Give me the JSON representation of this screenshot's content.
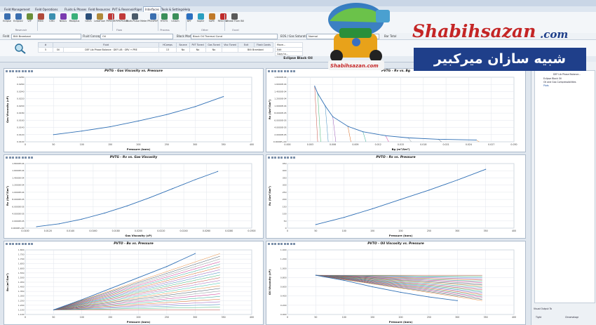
{
  "ribbon_tabs": [
    "Field Management",
    "Field Operations",
    "Fluids & Phases",
    "Field Resources",
    "PVT & Reservoir",
    "Rigel",
    "Interfaces",
    "Tools & Settings",
    "Help"
  ],
  "active_tab_index": 6,
  "ribbon_buttons": [
    {
      "label": "Eclipse",
      "icon": "eclipse-icon",
      "color": "#3a6fb0"
    },
    {
      "label": "Eclipse2",
      "icon": "eclipse2-icon",
      "color": "#3a6fb0"
    },
    {
      "label": "VIP",
      "icon": "vip-icon",
      "color": "#6a8f3a"
    },
    {
      "label": "IMEX",
      "icon": "imex-icon",
      "color": "#b04a3a"
    },
    {
      "label": "CMG",
      "icon": "cmg-icon",
      "color": "#3a8fb0"
    },
    {
      "label": "Nexus",
      "icon": "nexus-icon",
      "color": "#7a3ab0"
    },
    {
      "label": "Mbalplus",
      "icon": "mbal-icon",
      "color": "#3ab07a"
    },
    {
      "label": "GEUS",
      "icon": "geus-icon",
      "color": "#2a4f7a"
    },
    {
      "label": "LedaFlow",
      "icon": "leda-icon",
      "color": "#b08a3a"
    },
    {
      "label": "PIPESIM",
      "icon": "pipesim-icon",
      "color": "#c03a3a"
    },
    {
      "label": "PIPEPHASE",
      "icon": "pipephase-icon",
      "color": "#c03a3a"
    },
    {
      "label": "Multi-Phase Meter",
      "icon": "meter-icon",
      "color": "#4a5a6a"
    },
    {
      "label": "PROSPER",
      "icon": "prosper-icon",
      "color": "#3a6fb0"
    },
    {
      "label": "HYSYS",
      "icon": "hysys-icon",
      "color": "#3a8f5a"
    },
    {
      "label": "Unisim",
      "icon": "unisim-icon",
      "color": "#3a8f5a"
    },
    {
      "label": "BPF",
      "icon": "bpf-icon",
      "color": "#2a6fc0"
    },
    {
      "label": "Saphir",
      "icon": "saphir-icon",
      "color": "#2a9fc0"
    },
    {
      "label": "SAPE",
      "icon": "sape-icon",
      "color": "#c07a2a"
    },
    {
      "label": "RESOLVE",
      "icon": "resolve-icon",
      "color": "#c02a2a"
    },
    {
      "label": "Create From Bill",
      "icon": "create-icon",
      "color": "#5a5a5a"
    }
  ],
  "ribbon_groups": [
    {
      "label": "Reservoir"
    },
    {
      "label": "Flow"
    },
    {
      "label": "Process"
    },
    {
      "label": "Other"
    },
    {
      "label": "Excel"
    }
  ],
  "field_bar": {
    "field_label": "Field",
    "field_value": "Billi Brambani",
    "composition_label": "Fluid Concept",
    "composition_value": "Oil",
    "model_label": "Black Model",
    "model_value": "Black Oil Thermal Cond",
    "eos_label": "EOS / Gas Saturation",
    "eos_value": "Normal",
    "right_label": "Bar Total"
  },
  "header_table": {
    "columns": [
      "#",
      "Fluid",
      "HComps",
      "Source",
      "PVT Tuned",
      "Gas Tuned",
      "Visc Tuned",
      "Exit",
      "Flash Conds"
    ],
    "row": [
      "5",
      "Oil",
      "DEF Lib Phase Balance · DEF LIB · GRV + PRE",
      "13",
      "No",
      "No",
      "No",
      "",
      "Billi Brambani"
    ],
    "side_labels": [
      "Move...",
      "Edit",
      "Copy to..."
    ]
  },
  "content_title": "Eclipse Black Oil",
  "charts": [
    {
      "title": "PVTG - Gas Viscosity vs. Pressure",
      "xlabel": "Pressure (bara)",
      "ylabel": "Gas Viscosity (cP)"
    },
    {
      "title": "PVTG - Rv vs. Bg",
      "xlabel": "Bg (m³/Sm³)",
      "ylabel": "Rv (Sm³/Sm³)"
    },
    {
      "title": "PVTG - Rv vs. Gas Viscosity",
      "xlabel": "Gas Viscosity (cP)",
      "ylabel": "Rv (Sm³/Sm³)"
    },
    {
      "title": "PVTO - Rs vs. Pressure",
      "xlabel": "Pressure (bara)",
      "ylabel": "Rs (Sm³/Sm³)"
    },
    {
      "title": "PVTO - Bo vs. Pressure",
      "xlabel": "Pressure (bara)",
      "ylabel": "Bo (m³/Sm³)"
    },
    {
      "title": "PVTO - Oil Viscosity vs. Pressure",
      "xlabel": "Pressure (bara)",
      "ylabel": "Oil Viscosity (cP)"
    }
  ],
  "chart_data": [
    {
      "type": "line",
      "title": "PVTG - Gas Viscosity vs. Pressure",
      "xlabel": "Pressure (bara)",
      "ylabel": "Gas Viscosity (cP)",
      "xlim": [
        0,
        400
      ],
      "ylim": [
        0.01,
        0.028
      ],
      "x_ticks": [
        "0",
        "50",
        "100",
        "150",
        "200",
        "250",
        "300",
        "350",
        "400"
      ],
      "y_ticks": [
        "0.0100",
        "0.0120",
        "0.0140",
        "0.0160",
        "0.0180",
        "0.0200",
        "0.0220",
        "0.0240",
        "0.0260",
        "0.0280"
      ],
      "series": [
        {
          "x": [
            50,
            100,
            150,
            200,
            250,
            300,
            350
          ],
          "values": [
            0.012,
            0.013,
            0.0142,
            0.0158,
            0.0176,
            0.0198,
            0.0226
          ]
        }
      ]
    },
    {
      "type": "line",
      "title": "PVTG - Rv vs. Bg",
      "xlabel": "Bg (m³/Sm³)",
      "ylabel": "Rv (Sm³/Sm³)",
      "xlim": [
        0,
        0.03
      ],
      "ylim": [
        0,
        0.00018
      ],
      "x_ticks": [
        "0.000",
        "0.003",
        "0.006",
        "0.009",
        "0.012",
        "0.015",
        "0.018",
        "0.021",
        "0.024",
        "0.027",
        "0.030"
      ],
      "y_ticks": [
        "0.0000E+00",
        "2.0000E-05",
        "4.0000E-05",
        "6.0000E-05",
        "8.0000E-05",
        "1.0000E-04",
        "1.2000E-04",
        "1.4000E-04",
        "1.6000E-04",
        "1.8000E-04"
      ],
      "series": [
        {
          "x": [
            0.0036,
            0.004,
            0.005,
            0.006,
            0.008,
            0.01,
            0.013,
            0.016,
            0.02,
            0.025
          ],
          "values": [
            0.000155,
            0.000135,
            0.0001,
            7e-05,
            4.3e-05,
            2.8e-05,
            1.7e-05,
            1.1e-05,
            7e-06,
            5e-06
          ]
        }
      ]
    },
    {
      "type": "line",
      "title": "PVTG - Rv vs. Gas Viscosity",
      "xlabel": "Gas Viscosity (cP)",
      "ylabel": "Rv (Sm³/Sm³)",
      "xlim": [
        0.01,
        0.03
      ],
      "ylim": [
        0,
        0.00018
      ],
      "x_ticks": [
        "0.0100",
        "0.0120",
        "0.0140",
        "0.0160",
        "0.0180",
        "0.0200",
        "0.0220",
        "0.0240",
        "0.0260",
        "0.0280",
        "0.0300"
      ],
      "y_ticks": [
        "0.0000E+00",
        "2.0000E-05",
        "4.0000E-05",
        "6.0000E-05",
        "8.0000E-05",
        "1.0000E-04",
        "1.2000E-04",
        "1.4000E-04",
        "1.6000E-04",
        "1.8000E-04"
      ],
      "series": [
        {
          "x": [
            0.011,
            0.013,
            0.015,
            0.017,
            0.019,
            0.021,
            0.023,
            0.025,
            0.027
          ],
          "values": [
            4e-06,
            1.2e-05,
            2.5e-05,
            4.2e-05,
            6.2e-05,
            8.5e-05,
            0.00011,
            0.000135,
            0.000158
          ]
        }
      ]
    },
    {
      "type": "line",
      "title": "PVTO - Rs vs. Pressure",
      "xlabel": "Pressure (bara)",
      "ylabel": "Rs (Sm³/Sm³)",
      "xlim": [
        0,
        400
      ],
      "ylim": [
        0,
        450
      ],
      "x_ticks": [
        "0",
        "50",
        "100",
        "150",
        "200",
        "250",
        "300",
        "350",
        "400"
      ],
      "y_ticks": [
        "0",
        "50",
        "100",
        "150",
        "200",
        "250",
        "300",
        "350",
        "400",
        "450"
      ],
      "series": [
        {
          "x": [
            50,
            100,
            150,
            200,
            250,
            300,
            350
          ],
          "values": [
            25,
            75,
            135,
            200,
            265,
            335,
            410
          ]
        }
      ]
    },
    {
      "type": "line",
      "title": "PVTO - Bo vs. Pressure",
      "xlabel": "Pressure (bara)",
      "ylabel": "Bo (m³/Sm³)",
      "xlim": [
        0,
        400
      ],
      "ylim": [
        1.1,
        1.8
      ],
      "x_ticks": [
        "0",
        "50",
        "100",
        "150",
        "200",
        "250",
        "300",
        "350",
        "400"
      ],
      "y_ticks": [
        "1.100",
        "1.150",
        "1.200",
        "1.250",
        "1.300",
        "1.350",
        "1.400",
        "1.450",
        "1.500",
        "1.550",
        "1.600",
        "1.650",
        "1.700",
        "1.750",
        "1.800"
      ],
      "series": [
        {
          "x": [
            50,
            100,
            150,
            200,
            250,
            300
          ],
          "values": [
            1.15,
            1.26,
            1.38,
            1.5,
            1.62,
            1.76
          ]
        }
      ]
    },
    {
      "type": "line",
      "title": "PVTO - Oil Viscosity vs. Pressure",
      "xlabel": "Pressure (bara)",
      "ylabel": "Oil Viscosity (cP)",
      "xlim": [
        0,
        400
      ],
      "ylim": [
        0,
        1.4
      ],
      "x_ticks": [
        "0",
        "50",
        "100",
        "150",
        "200",
        "250",
        "300",
        "350",
        "400"
      ],
      "y_ticks": [
        "0.000",
        "0.200",
        "0.400",
        "0.600",
        "0.800",
        "1.000",
        "1.200",
        "1.400"
      ],
      "series": [
        {
          "x": [
            50,
            100,
            150,
            200,
            250,
            300
          ],
          "values": [
            0.85,
            0.74,
            0.6,
            0.48,
            0.38,
            0.3
          ]
        }
      ]
    }
  ],
  "sidebar": {
    "tree_items": [
      "DEF Lib Phase Balance...",
      "Eclipse Black Oil",
      "Oil and Gas Compressibilities",
      "Plots"
    ],
    "bottom_label": "Visual Output To",
    "bottom_opts": [
      "Tight",
      "Chromatogr"
    ]
  },
  "brand": {
    "name": "Shabihsazan",
    "domain": ".com",
    "persian": "شبیه سازان میرکبیر",
    "sub": "Shabihsazan.com"
  }
}
